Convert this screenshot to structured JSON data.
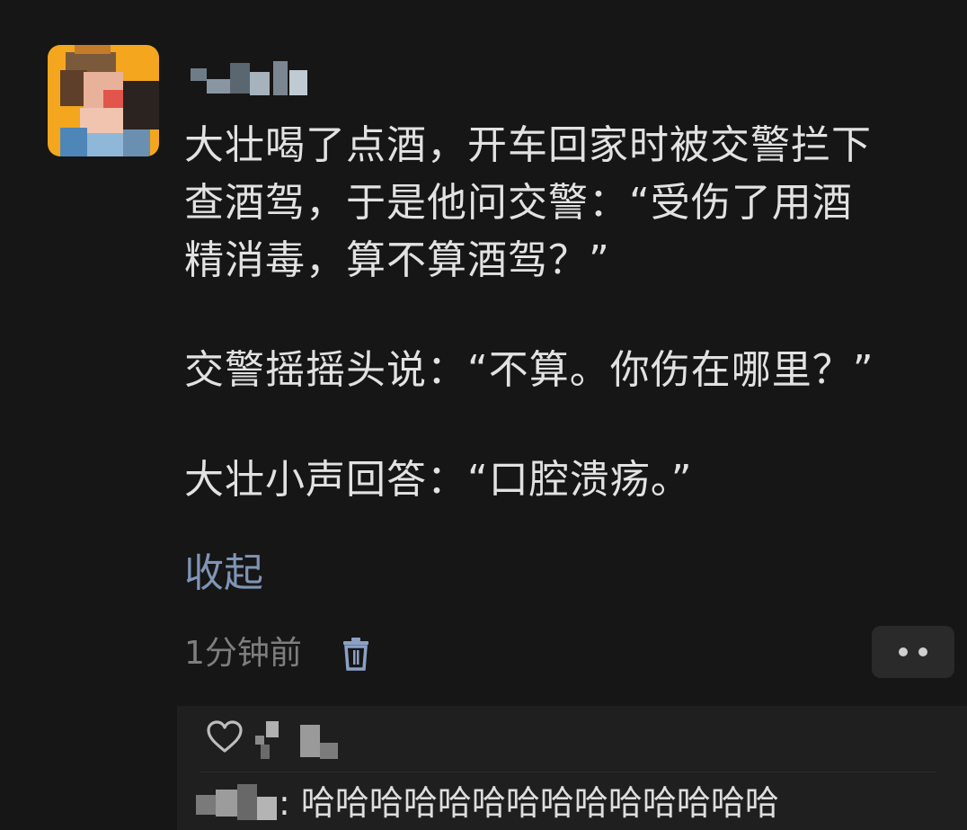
{
  "comment": {
    "paragraphs": [
      "大壮喝了点酒，开车回家时被交警拦下查酒驾，于是他问交警：“受伤了用酒精消毒，算不算酒驾？”",
      "交警摇摇头说：“不算。你伤在哪里？”",
      "大壮小声回答：“口腔溃疡。”"
    ],
    "lines": [
      "大壮喝了点酒，开车回家时被交警拦下",
      "查酒驾，于是他问交警：“受伤了用酒",
      "精消毒，算不算酒驾？”",
      "交警摇摇头说：“不算。你伤在哪里？”",
      "大壮小声回答：“口腔溃疡。”"
    ],
    "collapse_label": "收起",
    "time": "1分钟前"
  },
  "icons": {
    "delete": "trash-icon",
    "more": "more-dots-icon",
    "like": "heart-icon"
  },
  "reply": {
    "separator": ":",
    "text": "哈哈哈哈哈哈哈哈哈哈哈哈哈哈"
  },
  "colors": {
    "background": "#161616",
    "text": "#e2e2e2",
    "link": "#7f95b5",
    "muted": "#7e7e7e",
    "avatar_bg": "#f3a61e"
  }
}
